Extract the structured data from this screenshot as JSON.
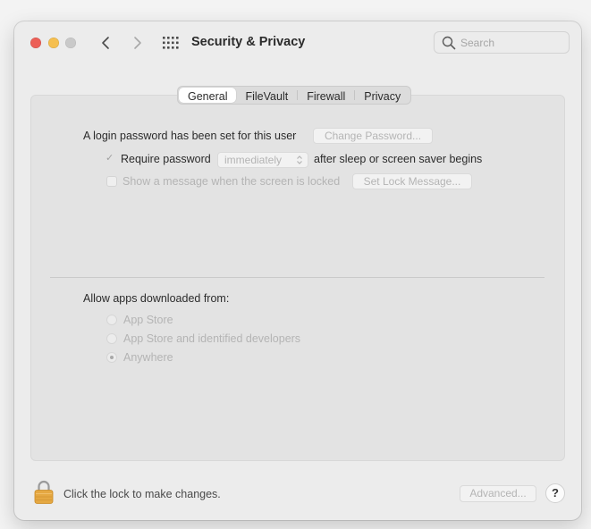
{
  "window": {
    "title": "Security & Privacy",
    "search_placeholder": "Search"
  },
  "tabs": [
    {
      "label": "General",
      "selected": true
    },
    {
      "label": "FileVault",
      "selected": false
    },
    {
      "label": "Firewall",
      "selected": false
    },
    {
      "label": "Privacy",
      "selected": false
    }
  ],
  "general": {
    "password_text": "A login password has been set for this user",
    "change_password_label": "Change Password...",
    "require_password_label": "Require password",
    "require_password_checked": true,
    "require_password_delay": "immediately",
    "after_sleep_text": "after sleep or screen saver begins",
    "show_message_label": "Show a message when the screen is locked",
    "show_message_checked": false,
    "set_lock_message_label": "Set Lock Message..."
  },
  "apps": {
    "heading": "Allow apps downloaded from:",
    "options": [
      {
        "label": "App Store",
        "selected": false
      },
      {
        "label": "App Store and identified developers",
        "selected": false
      },
      {
        "label": "Anywhere",
        "selected": true
      }
    ]
  },
  "footer": {
    "lock_text": "Click the lock to make changes.",
    "advanced_label": "Advanced...",
    "help_label": "?"
  },
  "icons": {
    "traffic_lights": [
      "close",
      "minimize",
      "zoom"
    ],
    "nav": [
      "back-chevron",
      "forward-chevron",
      "grid"
    ],
    "search": "magnifier",
    "lock": "padlock"
  },
  "colors": {
    "close": "#ec5f57",
    "minimize": "#f5bf4f",
    "zoom_disabled": "#c9c9c9",
    "lock_gold": "#e5a842"
  }
}
